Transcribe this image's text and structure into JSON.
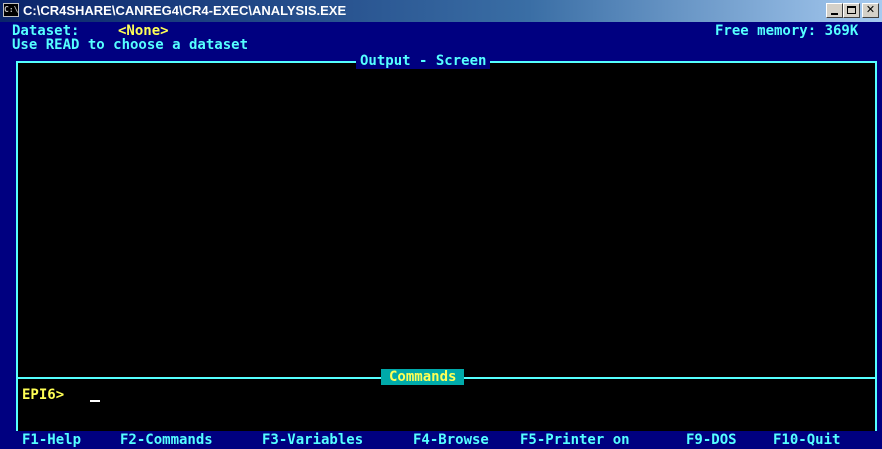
{
  "window": {
    "title": "C:\\CR4SHARE\\CANREG4\\CR4-EXEC\\ANALYSIS.EXE",
    "icon": "console-icon",
    "icon_text": "C:\\",
    "buttons": [
      "minimize",
      "maximize",
      "close"
    ]
  },
  "header": {
    "dataset_label": "Dataset:",
    "dataset_value": "<None>",
    "hint": "Use READ to choose a dataset",
    "memory": "Free memory: 369K"
  },
  "output": {
    "title": "Output - Screen"
  },
  "commands": {
    "title": "Commands",
    "prompt": "EPI6>"
  },
  "function_keys": [
    {
      "label": "F1-Help"
    },
    {
      "label": "F2-Commands"
    },
    {
      "label": "F3-Variables"
    },
    {
      "label": "F4-Browse"
    },
    {
      "label": "F5-Printer on"
    },
    {
      "label": "F9-DOS"
    },
    {
      "label": "F10-Quit"
    }
  ],
  "colors": {
    "background": "#000080",
    "text_cyan": "#55ffff",
    "text_yellow": "#ffff55",
    "panel": "#000000",
    "commands_bar": "#00aaaa"
  }
}
